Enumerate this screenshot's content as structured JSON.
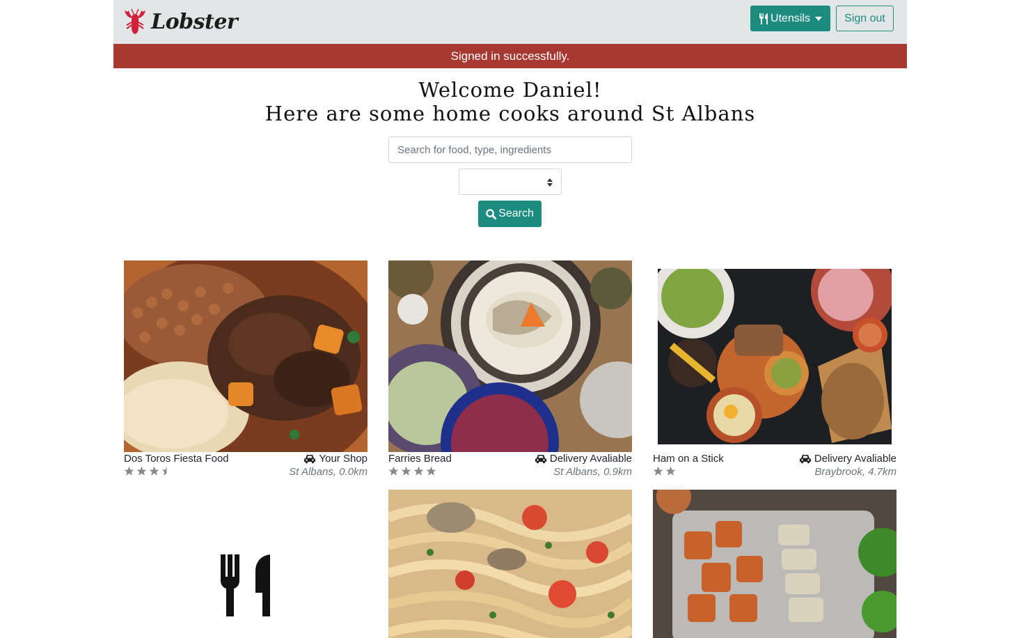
{
  "app": {
    "brand_name": "Lobster",
    "accent_color": "#1c8b80",
    "flash_color": "#a83832"
  },
  "navbar": {
    "utensils_label": "Utensils",
    "utensils_icon": "utensils-icon",
    "signout_label": "Sign out"
  },
  "flash": {
    "message": "Signed in successfully."
  },
  "welcome": {
    "line1": "Welcome Daniel!",
    "line2": "Here are some home cooks around St Albans"
  },
  "search": {
    "placeholder": "Search for food, type, ingredients",
    "value": "",
    "select_value": "",
    "button_label": "Search",
    "button_icon": "search-icon"
  },
  "cards": [
    {
      "name": "Dos Toros Fiesta Food",
      "delivery": "Your Shop",
      "location": "St Albans, 0.0km",
      "rating": 3.5,
      "image": "food-photo-beans-rice-stew"
    },
    {
      "name": "Farries Bread",
      "delivery": "Delivery Avaliable",
      "location": "St Albans, 0.9km",
      "rating": 4,
      "image": "food-photo-noodle-bowl"
    },
    {
      "name": "Ham on a Stick",
      "delivery": "Delivery Avaliable",
      "location": "Braybrook, 4.7km",
      "rating": 2,
      "image": "food-photo-tapas-spread"
    },
    {
      "name": "",
      "image": "utensils-placeholder-icon"
    },
    {
      "name": "",
      "image": "food-photo-seafood-pasta"
    },
    {
      "name": "",
      "image": "food-photo-sweet-potato-chicken"
    }
  ]
}
